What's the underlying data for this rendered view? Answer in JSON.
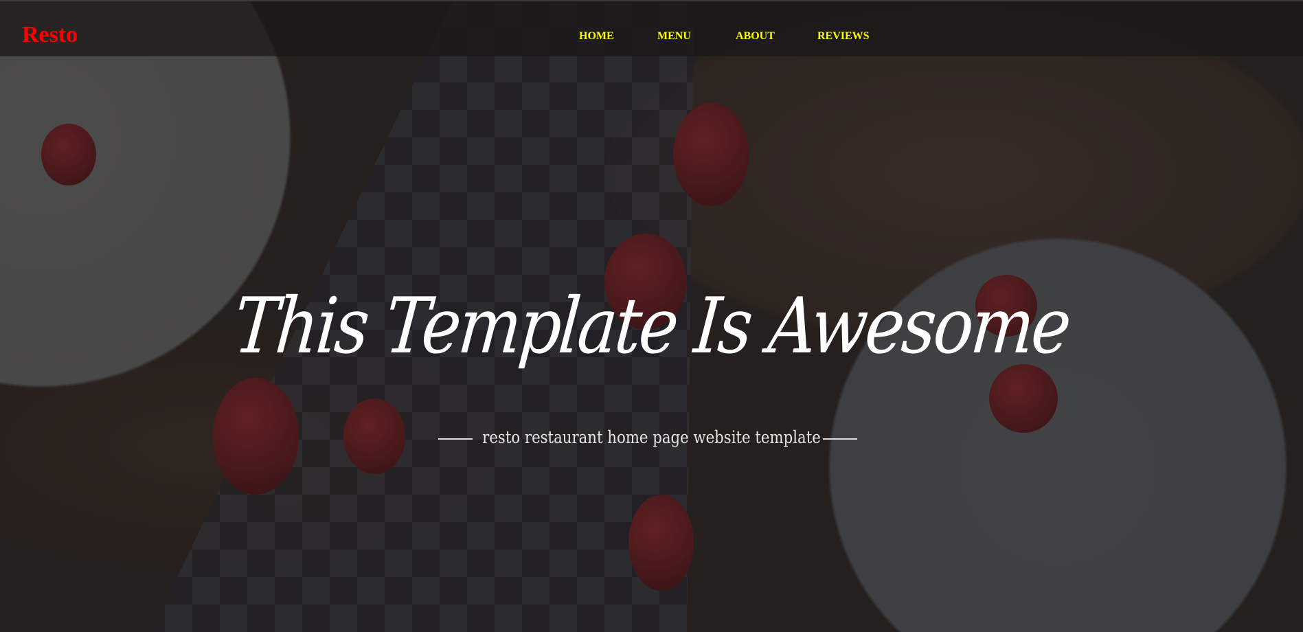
{
  "nav": {
    "logo": "Resto",
    "links": [
      {
        "label": "HOME"
      },
      {
        "label": "MENU"
      },
      {
        "label": "ABOUT"
      },
      {
        "label": "REVIEWS"
      }
    ]
  },
  "hero": {
    "title": "This Template Is Awesome",
    "subtitle": "resto restaurant home page website template"
  },
  "colors": {
    "logo": "#ff0000",
    "nav_links": "#ffff00"
  }
}
